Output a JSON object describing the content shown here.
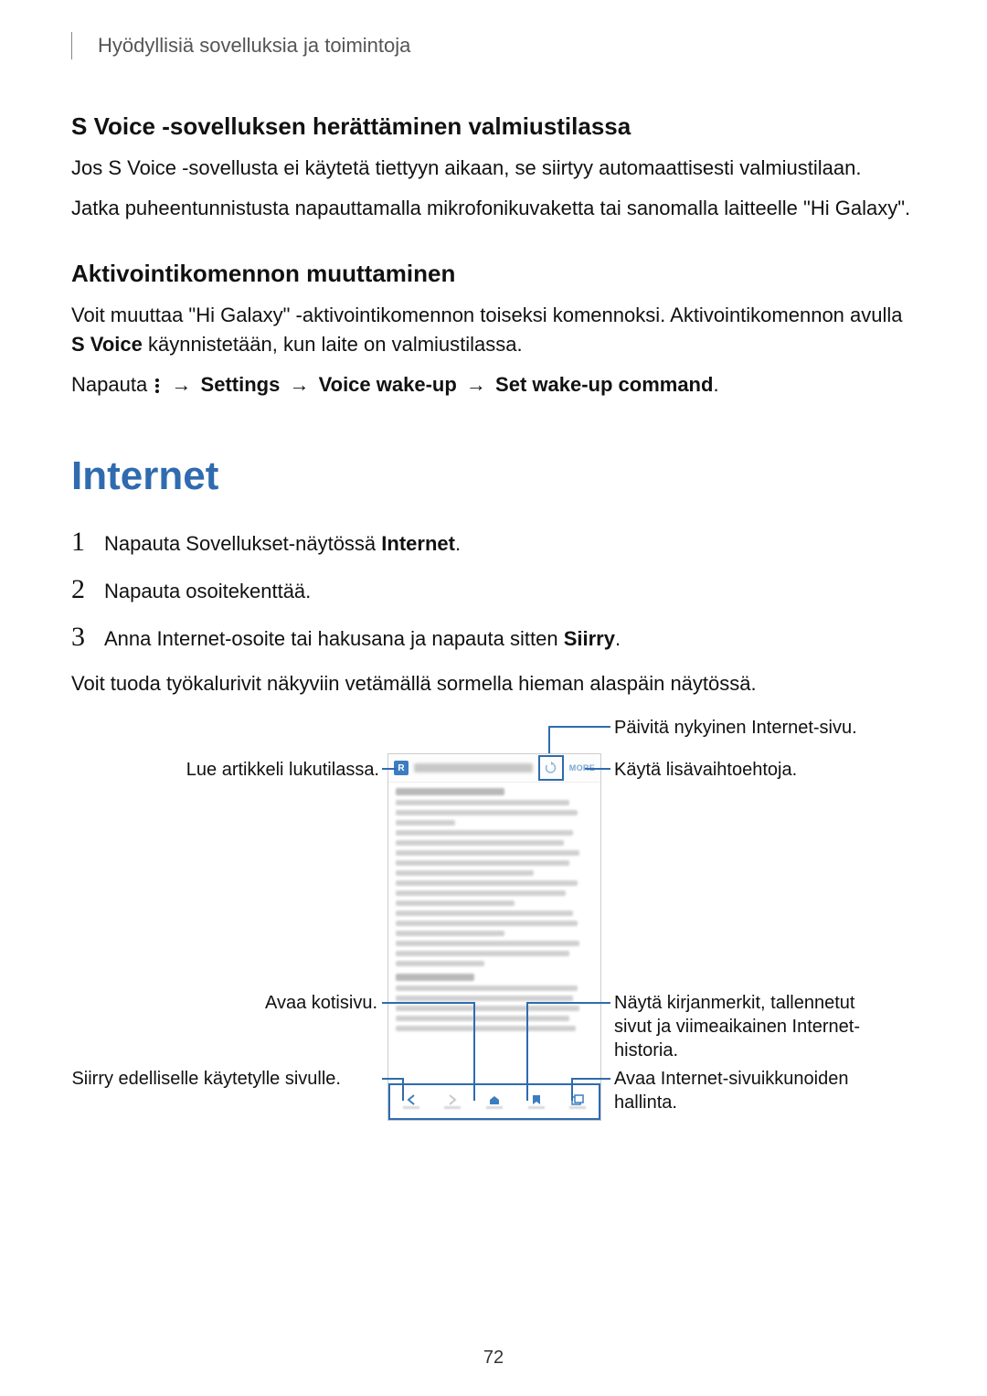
{
  "header": {
    "breadcrumb": "Hyödyllisiä sovelluksia ja toimintoja"
  },
  "section1": {
    "title": "S Voice -sovelluksen herättäminen valmiustilassa",
    "p1": "Jos S Voice -sovellusta ei käytetä tiettyyn aikaan, se siirtyy automaattisesti valmiustilaan.",
    "p2": "Jatka puheentunnistusta napauttamalla mikrofonikuvaketta tai sanomalla laitteelle \"Hi Galaxy\"."
  },
  "section2": {
    "title": "Aktivointikomennon muuttaminen",
    "p1a": "Voit muuttaa \"Hi Galaxy\" -aktivointikomennon toiseksi komennoksi. Aktivointikomennon avulla ",
    "p1b": "S Voice",
    "p1c": " käynnistetään, kun laite on valmiustilassa.",
    "p2a": "Napauta ",
    "p2b": "Settings",
    "p2c": "Voice wake-up",
    "p2d": "Set wake-up command",
    "arrow": "→"
  },
  "section3": {
    "title": "Internet",
    "steps": {
      "s1a": "Napauta Sovellukset-näytössä ",
      "s1b": "Internet",
      "s1c": ".",
      "s2": "Napauta osoitekenttää.",
      "s3a": "Anna Internet-osoite tai hakusana ja napauta sitten ",
      "s3b": "Siirry",
      "s3c": "."
    },
    "after": "Voit tuoda työkalurivit näkyviin vetämällä sormella hieman alaspäin näytössä."
  },
  "figure": {
    "callouts": {
      "refresh": "Päivitä nykyinen Internet-sivu.",
      "reader": "Lue artikkeli lukutilassa.",
      "more": "Käytä lisävaihtoehtoja.",
      "home": "Avaa kotisivu.",
      "bookmarks": "Näytä kirjanmerkit, tallennetut sivut ja viimeaikainen Internet-historia.",
      "back": "Siirry edelliselle käytetylle sivulle.",
      "tabs": "Avaa Internet-sivuikkunoiden hallinta."
    },
    "more_label": "MORE"
  },
  "page_number": "72"
}
